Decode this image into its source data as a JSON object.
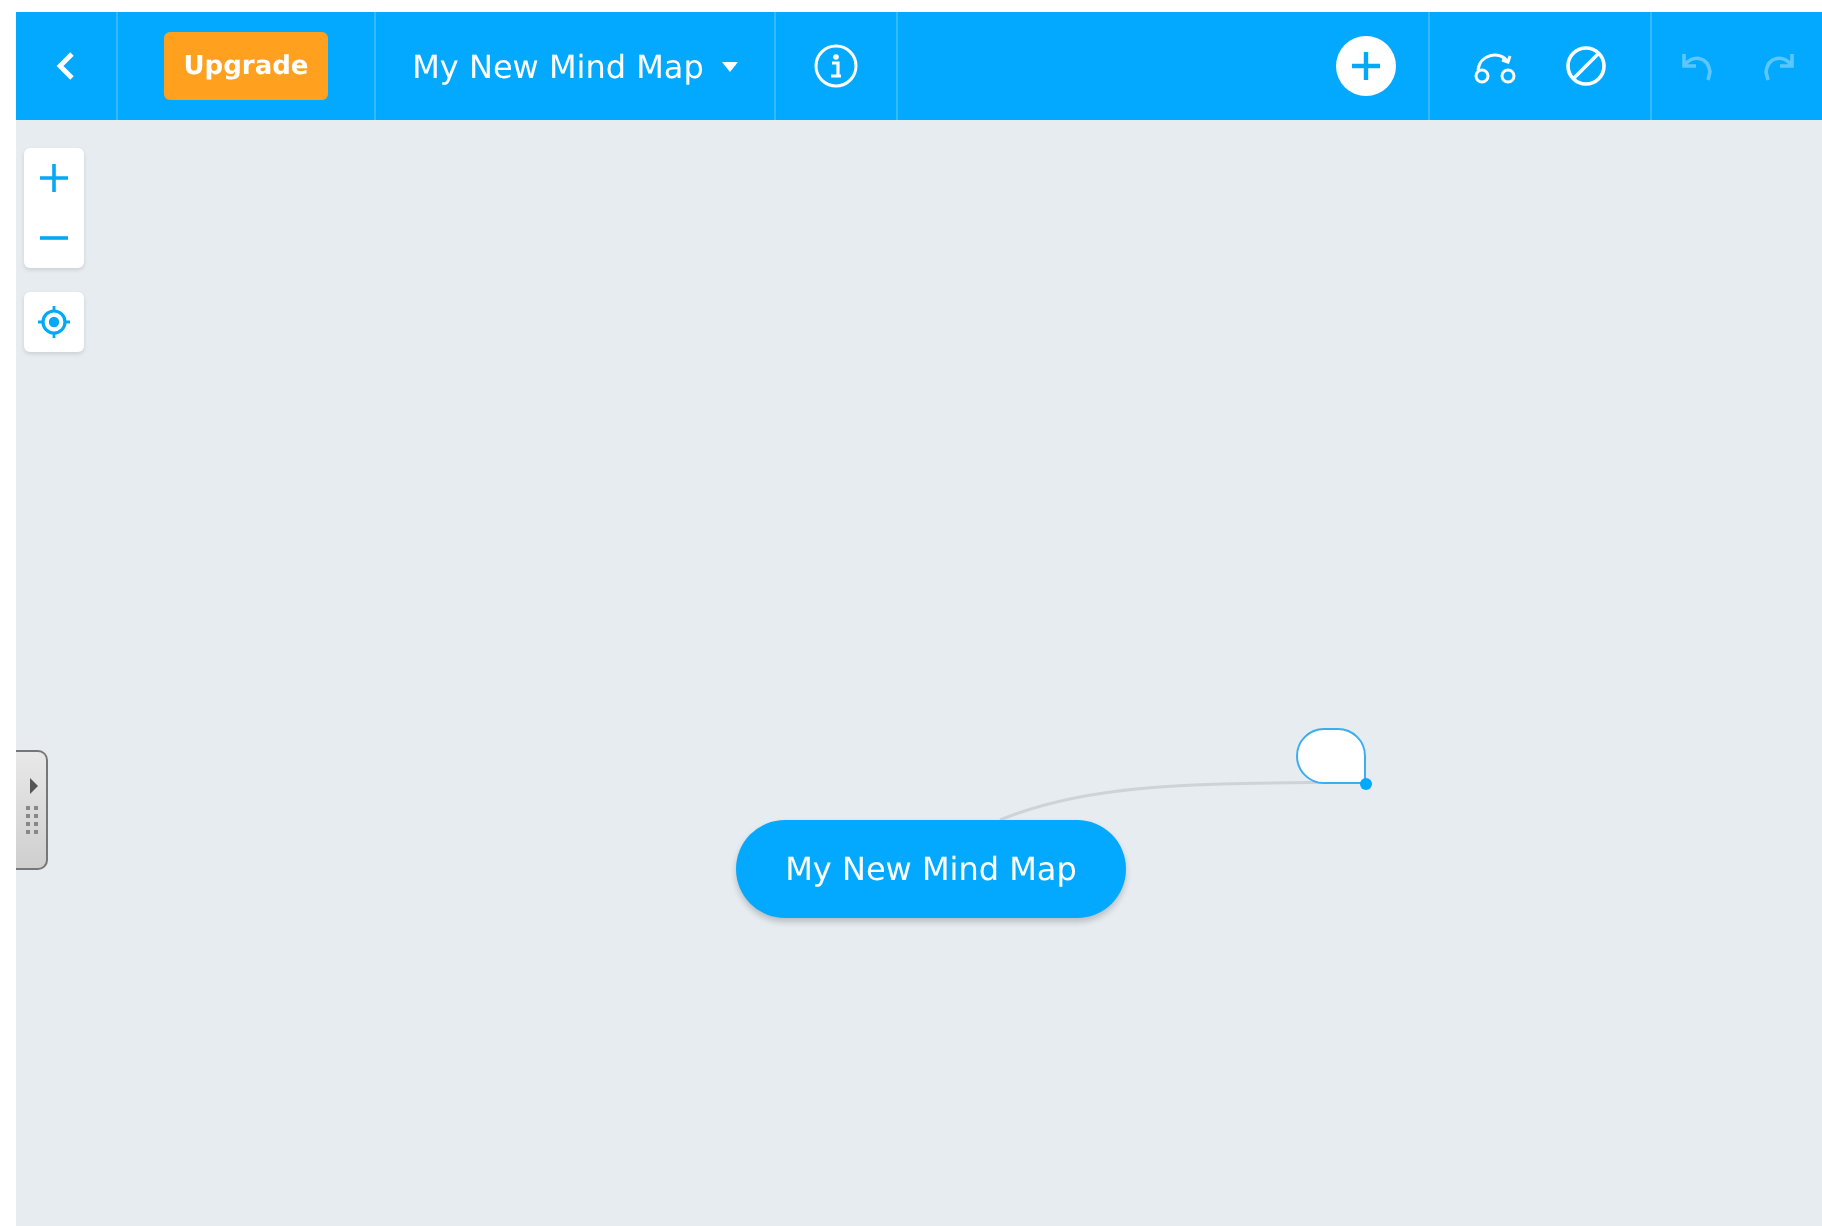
{
  "toolbar": {
    "upgrade_label": "Upgrade",
    "map_title": "My New Mind Map",
    "undo": {
      "disabled": true
    },
    "redo": {
      "disabled": true
    }
  },
  "canvas": {
    "nodes": [
      {
        "kind": "root",
        "text": "My New Mind Map"
      },
      {
        "kind": "empty",
        "selected": true
      }
    ]
  }
}
